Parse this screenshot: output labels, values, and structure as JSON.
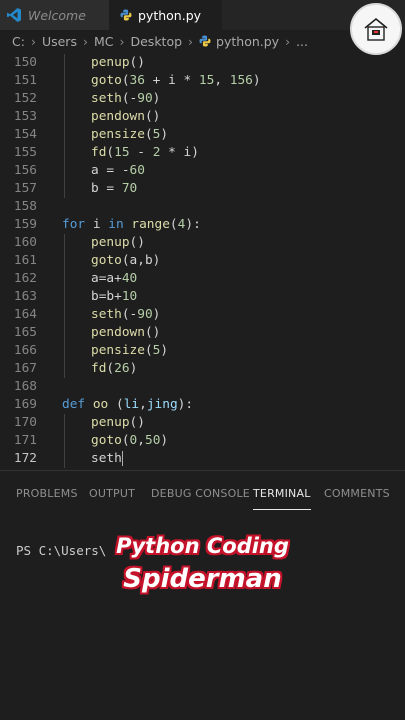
{
  "colors": {
    "background": "#1e1e1e",
    "keyword": "#569cd6",
    "function": "#dcdcaa",
    "number": "#b5cea8",
    "parameter": "#9cdcfe",
    "caption_outline": "#c4132a"
  },
  "tabs": {
    "welcome_label": "Welcome",
    "file_label": "python.py"
  },
  "breadcrumb": {
    "items": [
      "C:",
      "Users",
      "MC",
      "Desktop",
      "python.py",
      "..."
    ]
  },
  "editor": {
    "lines": [
      {
        "num": "150",
        "indent": 1,
        "tokens": [
          [
            "fn",
            "penup"
          ],
          [
            "p",
            "()"
          ]
        ]
      },
      {
        "num": "151",
        "indent": 1,
        "tokens": [
          [
            "fn",
            "goto"
          ],
          [
            "p",
            "("
          ],
          [
            "num",
            "36"
          ],
          [
            "p",
            " + i * "
          ],
          [
            "num",
            "15"
          ],
          [
            "p",
            ", "
          ],
          [
            "num",
            "156"
          ],
          [
            "p",
            ")"
          ]
        ]
      },
      {
        "num": "152",
        "indent": 1,
        "tokens": [
          [
            "fn",
            "seth"
          ],
          [
            "p",
            "(-"
          ],
          [
            "num",
            "90"
          ],
          [
            "p",
            ")"
          ]
        ]
      },
      {
        "num": "153",
        "indent": 1,
        "tokens": [
          [
            "fn",
            "pendown"
          ],
          [
            "p",
            "()"
          ]
        ]
      },
      {
        "num": "154",
        "indent": 1,
        "tokens": [
          [
            "fn",
            "pensize"
          ],
          [
            "p",
            "("
          ],
          [
            "num",
            "5"
          ],
          [
            "p",
            ")"
          ]
        ]
      },
      {
        "num": "155",
        "indent": 1,
        "tokens": [
          [
            "fn",
            "fd"
          ],
          [
            "p",
            "("
          ],
          [
            "num",
            "15"
          ],
          [
            "p",
            " - "
          ],
          [
            "num",
            "2"
          ],
          [
            "p",
            " * i)"
          ]
        ]
      },
      {
        "num": "156",
        "indent": 1,
        "tokens": [
          [
            "p",
            "a = -"
          ],
          [
            "num",
            "60"
          ]
        ]
      },
      {
        "num": "157",
        "indent": 1,
        "tokens": [
          [
            "p",
            "b = "
          ],
          [
            "num",
            "70"
          ]
        ]
      },
      {
        "num": "158",
        "indent": 0,
        "tokens": []
      },
      {
        "num": "159",
        "indent": 0,
        "tokens": [
          [
            "kw",
            "for"
          ],
          [
            "p",
            " i "
          ],
          [
            "kw",
            "in"
          ],
          [
            "p",
            " "
          ],
          [
            "fn",
            "range"
          ],
          [
            "p",
            "("
          ],
          [
            "num",
            "4"
          ],
          [
            "p",
            "):"
          ]
        ]
      },
      {
        "num": "160",
        "indent": 1,
        "tokens": [
          [
            "fn",
            "penup"
          ],
          [
            "p",
            "()"
          ]
        ]
      },
      {
        "num": "161",
        "indent": 1,
        "tokens": [
          [
            "fn",
            "goto"
          ],
          [
            "p",
            "(a,b)"
          ]
        ]
      },
      {
        "num": "162",
        "indent": 1,
        "tokens": [
          [
            "p",
            "a=a+"
          ],
          [
            "num",
            "40"
          ]
        ]
      },
      {
        "num": "163",
        "indent": 1,
        "tokens": [
          [
            "p",
            "b=b+"
          ],
          [
            "num",
            "10"
          ]
        ]
      },
      {
        "num": "164",
        "indent": 1,
        "tokens": [
          [
            "fn",
            "seth"
          ],
          [
            "p",
            "(-"
          ],
          [
            "num",
            "90"
          ],
          [
            "p",
            ")"
          ]
        ]
      },
      {
        "num": "165",
        "indent": 1,
        "tokens": [
          [
            "fn",
            "pendown"
          ],
          [
            "p",
            "()"
          ]
        ]
      },
      {
        "num": "166",
        "indent": 1,
        "tokens": [
          [
            "fn",
            "pensize"
          ],
          [
            "p",
            "("
          ],
          [
            "num",
            "5"
          ],
          [
            "p",
            ")"
          ]
        ]
      },
      {
        "num": "167",
        "indent": 1,
        "tokens": [
          [
            "fn",
            "fd"
          ],
          [
            "p",
            "("
          ],
          [
            "num",
            "26"
          ],
          [
            "p",
            ")"
          ]
        ]
      },
      {
        "num": "168",
        "indent": 0,
        "tokens": []
      },
      {
        "num": "169",
        "indent": 0,
        "tokens": [
          [
            "kw",
            "def"
          ],
          [
            "p",
            " "
          ],
          [
            "fn",
            "oo"
          ],
          [
            "p",
            " ("
          ],
          [
            "param",
            "li"
          ],
          [
            "p",
            ","
          ],
          [
            "param",
            "jing"
          ],
          [
            "p",
            "):"
          ]
        ]
      },
      {
        "num": "170",
        "indent": 1,
        "tokens": [
          [
            "fn",
            "penup"
          ],
          [
            "p",
            "()"
          ]
        ]
      },
      {
        "num": "171",
        "indent": 1,
        "tokens": [
          [
            "fn",
            "goto"
          ],
          [
            "p",
            "("
          ],
          [
            "num",
            "0"
          ],
          [
            "p",
            ","
          ],
          [
            "num",
            "50"
          ],
          [
            "p",
            ")"
          ]
        ]
      },
      {
        "num": "172",
        "indent": 1,
        "tokens": [
          [
            "p",
            "seth"
          ]
        ],
        "cursor": true
      }
    ]
  },
  "panel": {
    "tabs": [
      "PROBLEMS",
      "OUTPUT",
      "DEBUG CONSOLE",
      "TERMINAL",
      "COMMENTS"
    ],
    "active_tab": "TERMINAL",
    "terminal_prompt": "PS C:\\Users\\"
  },
  "caption": {
    "line1": "Python Coding",
    "line2": "Spiderman"
  }
}
